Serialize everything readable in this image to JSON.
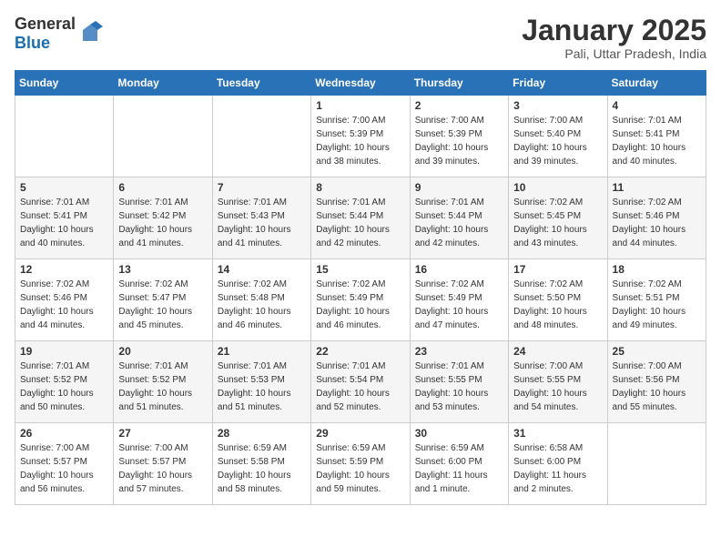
{
  "header": {
    "logo_general": "General",
    "logo_blue": "Blue",
    "month_title": "January 2025",
    "location": "Pali, Uttar Pradesh, India"
  },
  "weekdays": [
    "Sunday",
    "Monday",
    "Tuesday",
    "Wednesday",
    "Thursday",
    "Friday",
    "Saturday"
  ],
  "weeks": [
    [
      {
        "day": "",
        "info": ""
      },
      {
        "day": "",
        "info": ""
      },
      {
        "day": "",
        "info": ""
      },
      {
        "day": "1",
        "info": "Sunrise: 7:00 AM\nSunset: 5:39 PM\nDaylight: 10 hours\nand 38 minutes."
      },
      {
        "day": "2",
        "info": "Sunrise: 7:00 AM\nSunset: 5:39 PM\nDaylight: 10 hours\nand 39 minutes."
      },
      {
        "day": "3",
        "info": "Sunrise: 7:00 AM\nSunset: 5:40 PM\nDaylight: 10 hours\nand 39 minutes."
      },
      {
        "day": "4",
        "info": "Sunrise: 7:01 AM\nSunset: 5:41 PM\nDaylight: 10 hours\nand 40 minutes."
      }
    ],
    [
      {
        "day": "5",
        "info": "Sunrise: 7:01 AM\nSunset: 5:41 PM\nDaylight: 10 hours\nand 40 minutes."
      },
      {
        "day": "6",
        "info": "Sunrise: 7:01 AM\nSunset: 5:42 PM\nDaylight: 10 hours\nand 41 minutes."
      },
      {
        "day": "7",
        "info": "Sunrise: 7:01 AM\nSunset: 5:43 PM\nDaylight: 10 hours\nand 41 minutes."
      },
      {
        "day": "8",
        "info": "Sunrise: 7:01 AM\nSunset: 5:44 PM\nDaylight: 10 hours\nand 42 minutes."
      },
      {
        "day": "9",
        "info": "Sunrise: 7:01 AM\nSunset: 5:44 PM\nDaylight: 10 hours\nand 42 minutes."
      },
      {
        "day": "10",
        "info": "Sunrise: 7:02 AM\nSunset: 5:45 PM\nDaylight: 10 hours\nand 43 minutes."
      },
      {
        "day": "11",
        "info": "Sunrise: 7:02 AM\nSunset: 5:46 PM\nDaylight: 10 hours\nand 44 minutes."
      }
    ],
    [
      {
        "day": "12",
        "info": "Sunrise: 7:02 AM\nSunset: 5:46 PM\nDaylight: 10 hours\nand 44 minutes."
      },
      {
        "day": "13",
        "info": "Sunrise: 7:02 AM\nSunset: 5:47 PM\nDaylight: 10 hours\nand 45 minutes."
      },
      {
        "day": "14",
        "info": "Sunrise: 7:02 AM\nSunset: 5:48 PM\nDaylight: 10 hours\nand 46 minutes."
      },
      {
        "day": "15",
        "info": "Sunrise: 7:02 AM\nSunset: 5:49 PM\nDaylight: 10 hours\nand 46 minutes."
      },
      {
        "day": "16",
        "info": "Sunrise: 7:02 AM\nSunset: 5:49 PM\nDaylight: 10 hours\nand 47 minutes."
      },
      {
        "day": "17",
        "info": "Sunrise: 7:02 AM\nSunset: 5:50 PM\nDaylight: 10 hours\nand 48 minutes."
      },
      {
        "day": "18",
        "info": "Sunrise: 7:02 AM\nSunset: 5:51 PM\nDaylight: 10 hours\nand 49 minutes."
      }
    ],
    [
      {
        "day": "19",
        "info": "Sunrise: 7:01 AM\nSunset: 5:52 PM\nDaylight: 10 hours\nand 50 minutes."
      },
      {
        "day": "20",
        "info": "Sunrise: 7:01 AM\nSunset: 5:52 PM\nDaylight: 10 hours\nand 51 minutes."
      },
      {
        "day": "21",
        "info": "Sunrise: 7:01 AM\nSunset: 5:53 PM\nDaylight: 10 hours\nand 51 minutes."
      },
      {
        "day": "22",
        "info": "Sunrise: 7:01 AM\nSunset: 5:54 PM\nDaylight: 10 hours\nand 52 minutes."
      },
      {
        "day": "23",
        "info": "Sunrise: 7:01 AM\nSunset: 5:55 PM\nDaylight: 10 hours\nand 53 minutes."
      },
      {
        "day": "24",
        "info": "Sunrise: 7:00 AM\nSunset: 5:55 PM\nDaylight: 10 hours\nand 54 minutes."
      },
      {
        "day": "25",
        "info": "Sunrise: 7:00 AM\nSunset: 5:56 PM\nDaylight: 10 hours\nand 55 minutes."
      }
    ],
    [
      {
        "day": "26",
        "info": "Sunrise: 7:00 AM\nSunset: 5:57 PM\nDaylight: 10 hours\nand 56 minutes."
      },
      {
        "day": "27",
        "info": "Sunrise: 7:00 AM\nSunset: 5:57 PM\nDaylight: 10 hours\nand 57 minutes."
      },
      {
        "day": "28",
        "info": "Sunrise: 6:59 AM\nSunset: 5:58 PM\nDaylight: 10 hours\nand 58 minutes."
      },
      {
        "day": "29",
        "info": "Sunrise: 6:59 AM\nSunset: 5:59 PM\nDaylight: 10 hours\nand 59 minutes."
      },
      {
        "day": "30",
        "info": "Sunrise: 6:59 AM\nSunset: 6:00 PM\nDaylight: 11 hours\nand 1 minute."
      },
      {
        "day": "31",
        "info": "Sunrise: 6:58 AM\nSunset: 6:00 PM\nDaylight: 11 hours\nand 2 minutes."
      },
      {
        "day": "",
        "info": ""
      }
    ]
  ]
}
